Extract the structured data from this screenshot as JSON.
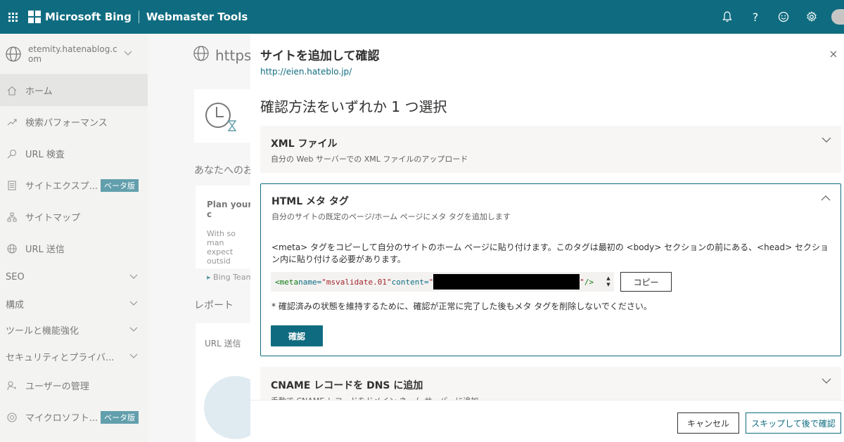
{
  "topbar": {
    "brand": "Microsoft Bing",
    "product": "Webmaster Tools"
  },
  "sidebar": {
    "site": "etemity.hatenablog.com",
    "items": [
      {
        "label": "ホーム",
        "icon": "home-icon"
      },
      {
        "label": "検索パフォーマンス",
        "icon": "trend-icon"
      },
      {
        "label": "URL 検査",
        "icon": "search-icon"
      },
      {
        "label": "サイトエクスプ...",
        "icon": "document-icon",
        "badge": "ベータ版"
      },
      {
        "label": "サイトマップ",
        "icon": "sitemap-icon"
      },
      {
        "label": "URL 送信",
        "icon": "globe-icon"
      }
    ],
    "groups": [
      "SEO",
      "構成",
      "ツールと機能強化",
      "セキュリティとプライバ..."
    ],
    "bottom_items": [
      {
        "label": "ユーザーの管理",
        "icon": "user-icon"
      },
      {
        "label": "マイクロソフト...",
        "icon": "microsoft-icon",
        "badge": "ベータ版"
      }
    ]
  },
  "main": {
    "url": "https:/",
    "intro": "あなたへのお",
    "plan_title": "Plan your c",
    "plan_body1": "With so man",
    "plan_body2": "expect outsid",
    "plan_author": "Bing Team",
    "report": "レポート",
    "url_submit": "URL 送信"
  },
  "panel": {
    "title": "サイトを追加して確認",
    "url": "http://eien.hateblo.jp/",
    "heading": "確認方法をいずれか 1 つ選択",
    "xml": {
      "title": "XML ファイル",
      "sub": "自分の Web サーバーでの XML ファイルのアップロード"
    },
    "html": {
      "title": "HTML メタ タグ",
      "sub": "自分のサイトの既定のページ/ホーム ページにメタ タグを追加します",
      "desc": "<meta> タグをコピーして自分のサイトのホーム ページに貼り付けます。このタグは最初の <body> セクションの前にある、<head> セクション内に貼り付ける必要があります。",
      "code_open": "<meta ",
      "code_name_attr": "name=",
      "code_name_val": "\"msvalidate.01\"",
      "code_content_attr": " content=",
      "code_q1": "\"",
      "code_q2": "\"",
      "code_close": " />",
      "copy": "コピー",
      "note": "* 確認済みの状態を維持するために、確認が正常に完了した後もメタ タグを削除しないでください。",
      "confirm": "確認"
    },
    "cname": {
      "title": "CNAME レコードを DNS に追加",
      "sub": "手動で CNAME レコードをドメイン ネーム サーバーに追加"
    },
    "cancel": "キャンセル",
    "skip": "スキップして後で確認"
  },
  "colors": {
    "accent": "#0f6c80"
  }
}
